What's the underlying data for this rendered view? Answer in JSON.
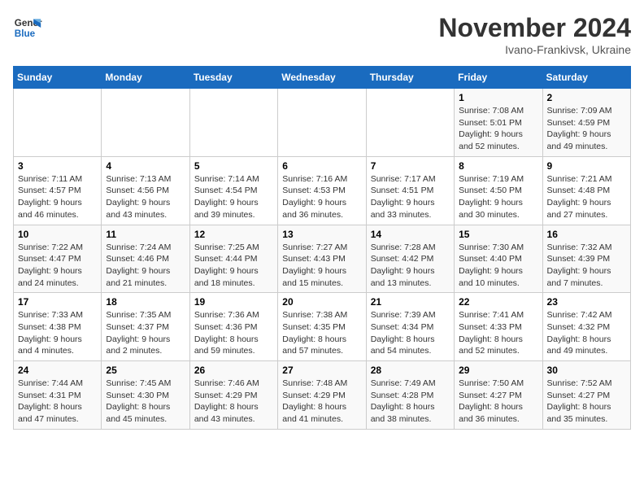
{
  "logo": {
    "line1": "General",
    "line2": "Blue"
  },
  "title": "November 2024",
  "location": "Ivano-Frankivsk, Ukraine",
  "days_of_week": [
    "Sunday",
    "Monday",
    "Tuesday",
    "Wednesday",
    "Thursday",
    "Friday",
    "Saturday"
  ],
  "weeks": [
    [
      {
        "day": "",
        "info": ""
      },
      {
        "day": "",
        "info": ""
      },
      {
        "day": "",
        "info": ""
      },
      {
        "day": "",
        "info": ""
      },
      {
        "day": "",
        "info": ""
      },
      {
        "day": "1",
        "info": "Sunrise: 7:08 AM\nSunset: 5:01 PM\nDaylight: 9 hours and 52 minutes."
      },
      {
        "day": "2",
        "info": "Sunrise: 7:09 AM\nSunset: 4:59 PM\nDaylight: 9 hours and 49 minutes."
      }
    ],
    [
      {
        "day": "3",
        "info": "Sunrise: 7:11 AM\nSunset: 4:57 PM\nDaylight: 9 hours and 46 minutes."
      },
      {
        "day": "4",
        "info": "Sunrise: 7:13 AM\nSunset: 4:56 PM\nDaylight: 9 hours and 43 minutes."
      },
      {
        "day": "5",
        "info": "Sunrise: 7:14 AM\nSunset: 4:54 PM\nDaylight: 9 hours and 39 minutes."
      },
      {
        "day": "6",
        "info": "Sunrise: 7:16 AM\nSunset: 4:53 PM\nDaylight: 9 hours and 36 minutes."
      },
      {
        "day": "7",
        "info": "Sunrise: 7:17 AM\nSunset: 4:51 PM\nDaylight: 9 hours and 33 minutes."
      },
      {
        "day": "8",
        "info": "Sunrise: 7:19 AM\nSunset: 4:50 PM\nDaylight: 9 hours and 30 minutes."
      },
      {
        "day": "9",
        "info": "Sunrise: 7:21 AM\nSunset: 4:48 PM\nDaylight: 9 hours and 27 minutes."
      }
    ],
    [
      {
        "day": "10",
        "info": "Sunrise: 7:22 AM\nSunset: 4:47 PM\nDaylight: 9 hours and 24 minutes."
      },
      {
        "day": "11",
        "info": "Sunrise: 7:24 AM\nSunset: 4:46 PM\nDaylight: 9 hours and 21 minutes."
      },
      {
        "day": "12",
        "info": "Sunrise: 7:25 AM\nSunset: 4:44 PM\nDaylight: 9 hours and 18 minutes."
      },
      {
        "day": "13",
        "info": "Sunrise: 7:27 AM\nSunset: 4:43 PM\nDaylight: 9 hours and 15 minutes."
      },
      {
        "day": "14",
        "info": "Sunrise: 7:28 AM\nSunset: 4:42 PM\nDaylight: 9 hours and 13 minutes."
      },
      {
        "day": "15",
        "info": "Sunrise: 7:30 AM\nSunset: 4:40 PM\nDaylight: 9 hours and 10 minutes."
      },
      {
        "day": "16",
        "info": "Sunrise: 7:32 AM\nSunset: 4:39 PM\nDaylight: 9 hours and 7 minutes."
      }
    ],
    [
      {
        "day": "17",
        "info": "Sunrise: 7:33 AM\nSunset: 4:38 PM\nDaylight: 9 hours and 4 minutes."
      },
      {
        "day": "18",
        "info": "Sunrise: 7:35 AM\nSunset: 4:37 PM\nDaylight: 9 hours and 2 minutes."
      },
      {
        "day": "19",
        "info": "Sunrise: 7:36 AM\nSunset: 4:36 PM\nDaylight: 8 hours and 59 minutes."
      },
      {
        "day": "20",
        "info": "Sunrise: 7:38 AM\nSunset: 4:35 PM\nDaylight: 8 hours and 57 minutes."
      },
      {
        "day": "21",
        "info": "Sunrise: 7:39 AM\nSunset: 4:34 PM\nDaylight: 8 hours and 54 minutes."
      },
      {
        "day": "22",
        "info": "Sunrise: 7:41 AM\nSunset: 4:33 PM\nDaylight: 8 hours and 52 minutes."
      },
      {
        "day": "23",
        "info": "Sunrise: 7:42 AM\nSunset: 4:32 PM\nDaylight: 8 hours and 49 minutes."
      }
    ],
    [
      {
        "day": "24",
        "info": "Sunrise: 7:44 AM\nSunset: 4:31 PM\nDaylight: 8 hours and 47 minutes."
      },
      {
        "day": "25",
        "info": "Sunrise: 7:45 AM\nSunset: 4:30 PM\nDaylight: 8 hours and 45 minutes."
      },
      {
        "day": "26",
        "info": "Sunrise: 7:46 AM\nSunset: 4:29 PM\nDaylight: 8 hours and 43 minutes."
      },
      {
        "day": "27",
        "info": "Sunrise: 7:48 AM\nSunset: 4:29 PM\nDaylight: 8 hours and 41 minutes."
      },
      {
        "day": "28",
        "info": "Sunrise: 7:49 AM\nSunset: 4:28 PM\nDaylight: 8 hours and 38 minutes."
      },
      {
        "day": "29",
        "info": "Sunrise: 7:50 AM\nSunset: 4:27 PM\nDaylight: 8 hours and 36 minutes."
      },
      {
        "day": "30",
        "info": "Sunrise: 7:52 AM\nSunset: 4:27 PM\nDaylight: 8 hours and 35 minutes."
      }
    ]
  ]
}
